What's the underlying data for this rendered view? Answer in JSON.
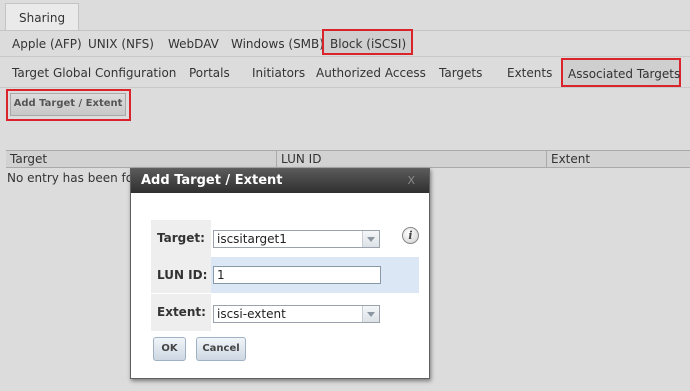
{
  "top_tab": "Sharing",
  "share_types": [
    "Apple (AFP)",
    "UNIX (NFS)",
    "WebDAV",
    "Windows (SMB)",
    "Block (iSCSI)"
  ],
  "iscsi_tabs": [
    "Target Global Configuration",
    "Portals",
    "Initiators",
    "Authorized Access",
    "Targets",
    "Extents",
    "Associated Targets"
  ],
  "add_button": "Add Target / Extent",
  "grid": {
    "columns": [
      "Target",
      "LUN ID",
      "Extent"
    ],
    "empty_text": "No entry has been fo"
  },
  "dialog": {
    "title": "Add Target / Extent",
    "close_glyph": "X",
    "target_label": "Target:",
    "target_value": "iscsitarget1",
    "lun_label": "LUN ID:",
    "lun_value": "1",
    "extent_label": "Extent:",
    "extent_value": "iscsi-extent",
    "info_glyph": "i",
    "ok_label": "OK",
    "cancel_label": "Cancel"
  },
  "colors": {
    "highlight": "#d9242c",
    "dialog_title_bg": "#3a3a3a",
    "row_highlight": "#dbe7f5"
  }
}
